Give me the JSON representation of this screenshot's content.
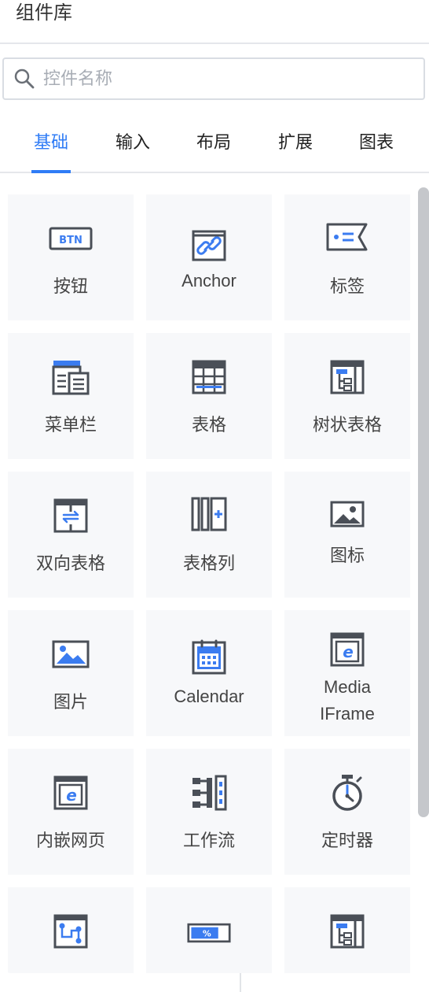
{
  "header": {
    "title": "组件库"
  },
  "search": {
    "placeholder": "控件名称",
    "value": ""
  },
  "tabs": [
    {
      "label": "基础",
      "active": true
    },
    {
      "label": "输入",
      "active": false
    },
    {
      "label": "布局",
      "active": false
    },
    {
      "label": "扩展",
      "active": false
    },
    {
      "label": "图表",
      "active": false
    }
  ],
  "colors": {
    "accent": "#2f7cf6",
    "icon_dark": "#4a4f57",
    "icon_blue": "#3b7cf0",
    "card_bg": "#f7f8fa"
  },
  "components": [
    {
      "label": "按钮",
      "icon": "button-icon"
    },
    {
      "label": "Anchor",
      "icon": "link-icon"
    },
    {
      "label": "标签",
      "icon": "tag-icon"
    },
    {
      "label": "菜单栏",
      "icon": "menu-bar-icon"
    },
    {
      "label": "表格",
      "icon": "table-icon"
    },
    {
      "label": "树状表格",
      "icon": "tree-table-icon"
    },
    {
      "label": "双向表格",
      "icon": "bidirectional-table-icon"
    },
    {
      "label": "表格列",
      "icon": "table-column-icon"
    },
    {
      "label": "图标",
      "icon": "image-icon"
    },
    {
      "label": "图片",
      "icon": "picture-icon"
    },
    {
      "label": "Calendar",
      "icon": "calendar-icon"
    },
    {
      "label": "Media IFrame",
      "label_lines": [
        "Media",
        "IFrame"
      ],
      "icon": "media-iframe-icon"
    },
    {
      "label": "内嵌网页",
      "icon": "embedded-webpage-icon"
    },
    {
      "label": "工作流",
      "icon": "workflow-icon"
    },
    {
      "label": "定时器",
      "icon": "timer-icon"
    },
    {
      "label": "",
      "icon": "flow-chart-icon"
    },
    {
      "label": "",
      "icon": "progress-bar-icon"
    },
    {
      "label": "",
      "icon": "tree-table-icon"
    }
  ]
}
